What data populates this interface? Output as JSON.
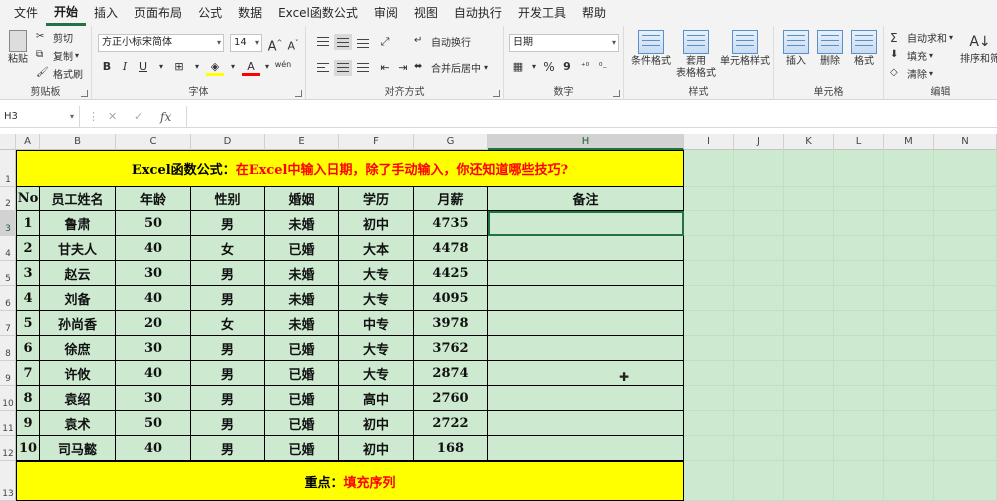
{
  "menu": [
    "文件",
    "开始",
    "插入",
    "页面布局",
    "公式",
    "数据",
    "Excel函数公式",
    "审阅",
    "视图",
    "自动执行",
    "开发工具",
    "帮助"
  ],
  "menu_active": 1,
  "ribbon": {
    "clipboard": {
      "label": "剪贴板",
      "paste": "粘贴",
      "cut": "剪切",
      "copy": "复制",
      "format_painter": "格式刷"
    },
    "font": {
      "label": "字体",
      "font_name": "方正小标宋简体",
      "font_size": "14",
      "bold": "B",
      "italic": "I",
      "underline": "U",
      "grow": "A",
      "shrink": "A",
      "wen": "wén"
    },
    "alignment": {
      "label": "对齐方式",
      "wrap": "自动换行",
      "merge": "合并后居中"
    },
    "number": {
      "label": "数字",
      "format": "日期",
      "percent": "%",
      "comma": "9"
    },
    "styles": {
      "label": "样式",
      "conditional": "条件格式",
      "table": "套用\n表格格式",
      "cell_styles": "单元格样式"
    },
    "cells": {
      "label": "单元格",
      "insert": "插入",
      "delete": "删除",
      "format": "格式"
    },
    "editing": {
      "label": "编辑",
      "autosum": "自动求和",
      "fill": "填充",
      "clear": "清除",
      "sort": "排序和筛"
    }
  },
  "formula_bar": {
    "name_box": "H3",
    "fx": "fx",
    "value": ""
  },
  "columns": [
    "A",
    "B",
    "C",
    "D",
    "E",
    "F",
    "G",
    "H",
    "I",
    "J",
    "K",
    "L",
    "M",
    "N"
  ],
  "selected_column": "H",
  "rows": [
    "1",
    "2",
    "3",
    "4",
    "5",
    "6",
    "7",
    "8",
    "9",
    "10",
    "11",
    "12",
    "13"
  ],
  "selected_row": "3",
  "sheet": {
    "title_black": "Excel函数公式：",
    "title_red": "在Excel中输入日期，除了手动输入，你还知道哪些技巧?",
    "headers": [
      "No",
      "员工姓名",
      "年龄",
      "性别",
      "婚姻",
      "学历",
      "月薪",
      "备注"
    ],
    "records": [
      [
        "1",
        "鲁肃",
        "50",
        "男",
        "未婚",
        "初中",
        "4735",
        ""
      ],
      [
        "2",
        "甘夫人",
        "40",
        "女",
        "已婚",
        "大本",
        "4478",
        ""
      ],
      [
        "3",
        "赵云",
        "30",
        "男",
        "未婚",
        "大专",
        "4425",
        ""
      ],
      [
        "4",
        "刘备",
        "40",
        "男",
        "未婚",
        "大专",
        "4095",
        ""
      ],
      [
        "5",
        "孙尚香",
        "20",
        "女",
        "未婚",
        "中专",
        "3978",
        ""
      ],
      [
        "6",
        "徐庶",
        "30",
        "男",
        "已婚",
        "大专",
        "3762",
        ""
      ],
      [
        "7",
        "许攸",
        "40",
        "男",
        "已婚",
        "大专",
        "2874",
        ""
      ],
      [
        "8",
        "袁绍",
        "30",
        "男",
        "已婚",
        "高中",
        "2760",
        ""
      ],
      [
        "9",
        "袁术",
        "50",
        "男",
        "已婚",
        "初中",
        "2722",
        ""
      ],
      [
        "10",
        "司马懿",
        "40",
        "男",
        "已婚",
        "初中",
        "168",
        ""
      ]
    ],
    "footer_black": "重点：",
    "footer_red": "填充序列"
  },
  "colors": {
    "accent": "#217346",
    "sheet_bg": "#cde9d0",
    "title_bg": "#ffff00",
    "title_red": "#ff0000"
  }
}
